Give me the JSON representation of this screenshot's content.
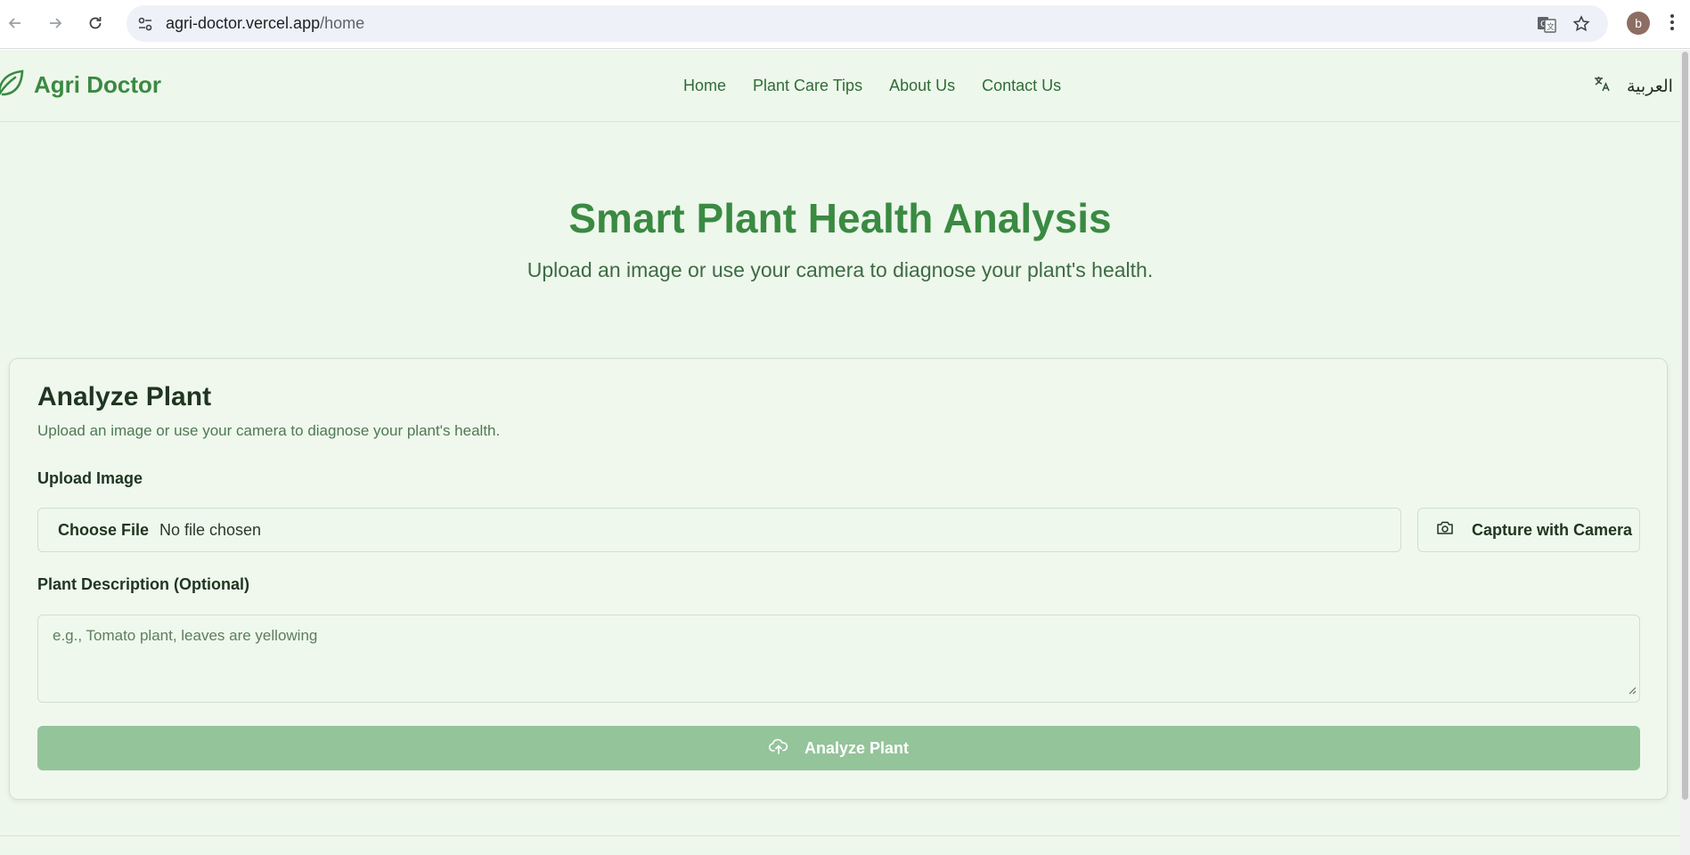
{
  "browser": {
    "url_host": "agri-doctor.vercel.app",
    "url_path": "/home",
    "profile_initial": "b"
  },
  "header": {
    "brand": "Agri Doctor",
    "nav": [
      "Home",
      "Plant Care Tips",
      "About Us",
      "Contact Us"
    ],
    "language_label": "العربية"
  },
  "hero": {
    "title": "Smart Plant Health Analysis",
    "subtitle": "Upload an image or use your camera to diagnose your plant's health."
  },
  "card": {
    "title": "Analyze Plant",
    "description": "Upload an image or use your camera to diagnose your plant's health.",
    "upload_label": "Upload Image",
    "file_button": "Choose File",
    "file_status": "No file chosen",
    "camera_button": "Capture with Camera",
    "description_label": "Plant Description (Optional)",
    "description_placeholder": "e.g., Tomato plant, leaves are yellowing",
    "analyze_button": "Analyze Plant"
  },
  "colors": {
    "accent": "#3a8a42",
    "page_bg": "#eef7ec",
    "button_disabled": "#94c49a"
  },
  "icons": [
    "back-icon",
    "forward-icon",
    "reload-icon",
    "site-settings-icon",
    "translate-icon",
    "bookmark-star-icon",
    "menu-kebab-icon",
    "leaf-icon",
    "language-icon",
    "camera-icon",
    "upload-cloud-icon"
  ]
}
